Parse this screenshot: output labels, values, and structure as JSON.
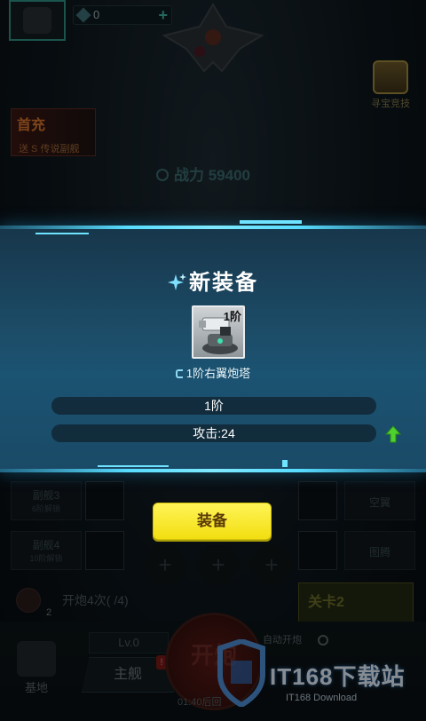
{
  "background": {
    "gems": "0",
    "treasure_label": "寻宝竞技",
    "first_charge": {
      "title": "首充",
      "subtitle": "送 S 传说副舰"
    },
    "combat_power": "战力 59400",
    "slots": {
      "left": [
        {
          "name": "副舰3",
          "unlock": "6阶解锁"
        },
        {
          "name": "副舰4",
          "unlock": "10阶解锁"
        }
      ],
      "right": [
        "空翼",
        "图腾"
      ]
    },
    "fire_row": {
      "count": "2",
      "text": "开炮4次( /4)"
    },
    "stage": "关卡2",
    "base": "基地",
    "level": "Lv.0",
    "main_ship": "主舰",
    "fire_button": "开炮",
    "timer": "01:40后回",
    "auto_fire": "自动开炮",
    "badge": "!",
    "watermark": {
      "title": "IT168下载站",
      "subtitle": "IT168 Download"
    }
  },
  "modal": {
    "title": "新装备",
    "item": {
      "tier_badge": "1阶",
      "name": "1阶右翼炮塔"
    },
    "stats": {
      "tier": "1阶",
      "attack": "攻击:24"
    },
    "equip_button": "装备"
  },
  "colors": {
    "panel": "#1c4d69",
    "panel_edge": "#58dcff",
    "button": "#f6e428",
    "arrow": "#4fd12e"
  }
}
